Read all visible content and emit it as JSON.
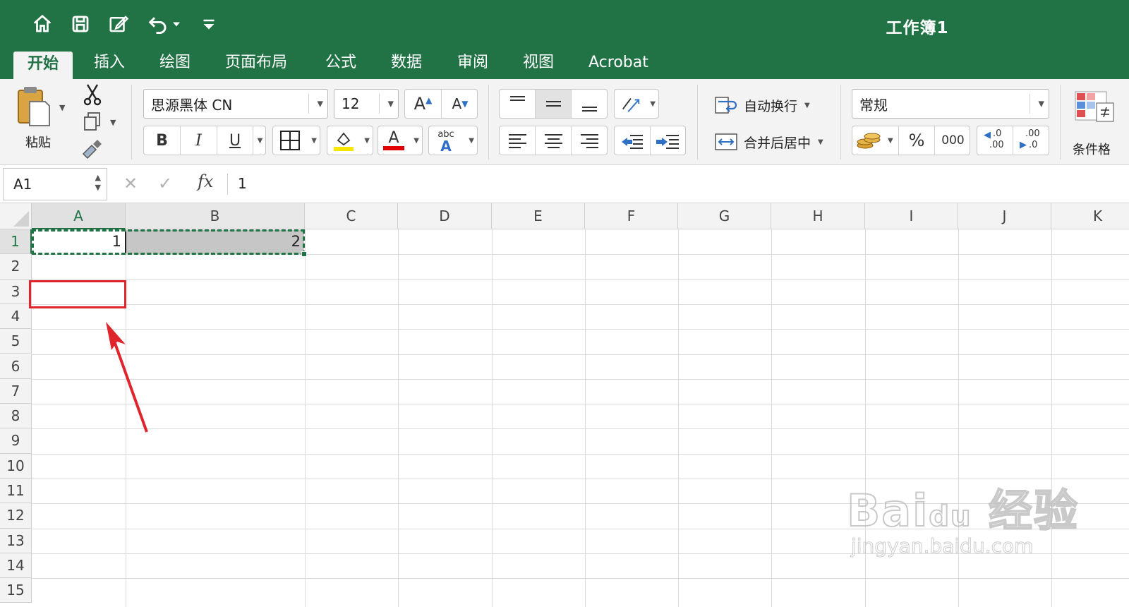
{
  "titlebar": {
    "doc_title": "工作簿1",
    "quick_access": [
      "home-icon",
      "save-icon",
      "edit-icon",
      "undo-icon",
      "customize-icon"
    ]
  },
  "tabs": [
    {
      "label": "开始",
      "active": true
    },
    {
      "label": "插入"
    },
    {
      "label": "绘图"
    },
    {
      "label": "页面布局"
    },
    {
      "label": "公式"
    },
    {
      "label": "数据"
    },
    {
      "label": "审阅"
    },
    {
      "label": "视图"
    },
    {
      "label": "Acrobat"
    }
  ],
  "ribbon": {
    "paste_label": "粘贴",
    "font_name": "思源黑体 CN",
    "font_size": "12",
    "grow_font": "A",
    "shrink_font": "A",
    "bold": "B",
    "italic": "I",
    "underline": "U",
    "font_color_glyph": "A",
    "phonetic_small": "abc",
    "phonetic_big": "A",
    "wrap_text": "自动换行",
    "merge_center": "合并后居中",
    "number_format": "常规",
    "percent": "%",
    "comma": "000",
    "increase_decimal_top": ".0",
    "increase_decimal_bottom": ".00",
    "decrease_decimal_top": ".00",
    "decrease_decimal_bottom": ".0",
    "conditional_format": "条件格"
  },
  "formula_bar": {
    "name_box": "A1",
    "fx": "fx",
    "value": "1"
  },
  "grid": {
    "columns": [
      "A",
      "B",
      "C",
      "D",
      "E",
      "F",
      "G",
      "H",
      "I",
      "J",
      "K"
    ],
    "rows": [
      "1",
      "2",
      "3",
      "4",
      "5",
      "6",
      "7",
      "8",
      "9",
      "10",
      "11",
      "12",
      "13",
      "14",
      "15"
    ],
    "selected_column": "A",
    "selected_row": "1",
    "cells": {
      "A1": "1",
      "B1": "2"
    }
  },
  "watermark": {
    "logo": "Bai du 经验",
    "url": "jingyan.baidu.com"
  },
  "colors": {
    "excel_green": "#217346",
    "annotation_red": "#e0242b"
  }
}
